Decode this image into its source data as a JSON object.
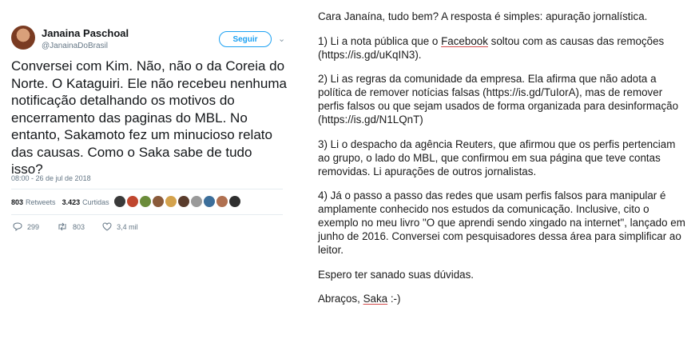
{
  "tweet": {
    "author_name": "Janaina Paschoal",
    "handle": "@JanainaDoBrasil",
    "follow_label": "Seguir",
    "text": "Conversei com Kim. Não, não o da Coreia do Norte. O Kataguiri. Ele não recebeu nenhuma notificação detalhando os motivos do encerramento das paginas do MBL. No entanto, Sakamoto fez um minucioso relato das causas. Como o Saka sabe de tudo isso?",
    "date": "08:00 - 26 de jul de 2018",
    "retweets_count": "803",
    "retweets_label": "Retweets",
    "likes_count": "3.423",
    "likes_label": "Curtidas",
    "liker_colors": [
      "#3a3a3a",
      "#c0462e",
      "#6b8c3a",
      "#8a5a3a",
      "#d4a24c",
      "#5a3c2c",
      "#9a9a9a",
      "#3c6e9a",
      "#b07050",
      "#2f2f2f"
    ],
    "actions": {
      "replies": "299",
      "retweets": "803",
      "likes": "3,4 mil"
    }
  },
  "reply": {
    "greeting": "Cara Janaína, tudo bem? A resposta é simples: apuração jornalística.",
    "p1_a": "1) Li a nota pública que o ",
    "p1_link": "Facebook",
    "p1_b": " soltou com as causas das remoções (https://is.gd/uKqIN3).",
    "p2": "2) Li as regras da comunidade da empresa. Ela afirma que não adota a política de remover notícias falsas (https://is.gd/TuIorA), mas de remover perfis falsos ou que sejam usados de forma organizada para desinformação (https://is.gd/N1LQnT)",
    "p3": "3) Li o despacho da agência Reuters, que afirmou que os perfis pertenciam ao grupo, o lado do MBL, que confirmou em sua página que teve contas removidas. Li apurações de outros jornalistas.",
    "p4": "4) Já o passo a passo das redes que usam perfis falsos para manipular é amplamente conhecido nos estudos da comunicação. Inclusive, cito o exemplo no meu livro \"O que aprendi sendo xingado na internet\", lançado em junho de 2016. Conversei com pesquisadores dessa área para simplificar ao leitor.",
    "closing": "Espero ter sanado suas dúvidas.",
    "signoff_a": "Abraços, ",
    "signoff_name": "Saka",
    "signoff_b": " :-)"
  }
}
